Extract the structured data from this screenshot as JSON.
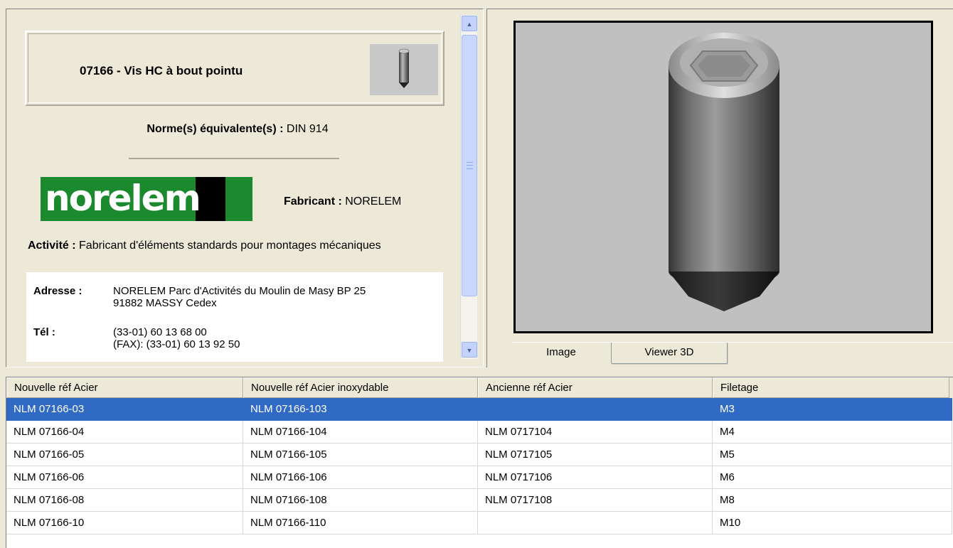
{
  "product": {
    "title": "07166 - Vis HC à bout pointu",
    "norme_label": "Norme(s) équivalente(s) :",
    "norme_value": "DIN 914",
    "logo_text": "norelem",
    "fabricant_label": "Fabricant :",
    "fabricant_value": "NORELEM",
    "activite_label": "Activité :",
    "activite_value": "Fabricant d'éléments standards pour montages mécaniques",
    "adresse_label": "Adresse :",
    "adresse_line1": "NORELEM Parc d'Activités du Moulin de Masy BP 25",
    "adresse_line2": "91882 MASSY Cedex",
    "tel_label": "Tél :",
    "tel_line1": "(33-01) 60 13 68 00",
    "tel_line2": "(FAX): (33-01) 60 13 92 50"
  },
  "scrollbar": {
    "up_icon": "▲",
    "down_icon": "▼"
  },
  "viewer": {
    "tabs": [
      {
        "label": "Image",
        "active": true
      },
      {
        "label": "Viewer 3D",
        "active": false
      }
    ]
  },
  "grid": {
    "columns": [
      "Nouvelle réf Acier",
      "Nouvelle réf Acier inoxydable",
      "Ancienne réf Acier",
      "Filetage"
    ],
    "rows": [
      [
        "NLM 07166-03",
        "NLM 07166-103",
        "",
        "M3"
      ],
      [
        "NLM 07166-04",
        "NLM 07166-104",
        "NLM 0717104",
        "M4"
      ],
      [
        "NLM 07166-05",
        "NLM 07166-105",
        "NLM 0717105",
        "M5"
      ],
      [
        "NLM 07166-06",
        "NLM 07166-106",
        "NLM 0717106",
        "M6"
      ],
      [
        "NLM 07166-08",
        "NLM 07166-108",
        "NLM 0717108",
        "M8"
      ],
      [
        "NLM 07166-10",
        "NLM 07166-110",
        "",
        "M10"
      ]
    ],
    "selected_row": 0
  },
  "colors": {
    "selection": "#316ac5",
    "logo_green": "#1b8a2e",
    "window_bg": "#ece9d8"
  }
}
